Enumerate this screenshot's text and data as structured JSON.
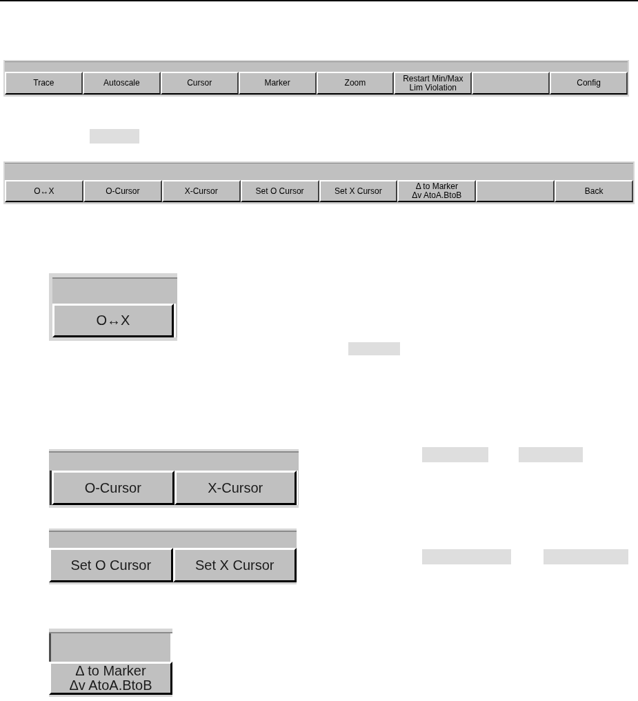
{
  "softkey_bars": [
    {
      "buttons": [
        {
          "kind": "text",
          "lines": [
            "Trace"
          ]
        },
        {
          "kind": "text",
          "lines": [
            "Autoscale"
          ]
        },
        {
          "kind": "text",
          "lines": [
            "Cursor"
          ]
        },
        {
          "kind": "text",
          "lines": [
            "Marker"
          ]
        },
        {
          "kind": "text",
          "lines": [
            "Zoom"
          ]
        },
        {
          "kind": "text",
          "lines": [
            "Restart Min/Max",
            "Lim Violation"
          ]
        },
        {
          "kind": "empty"
        },
        {
          "kind": "text",
          "lines": [
            "Config"
          ]
        }
      ]
    },
    {
      "buttons": [
        {
          "kind": "text",
          "lines": [
            "O↔X"
          ]
        },
        {
          "kind": "text",
          "lines": [
            "O-Cursor"
          ]
        },
        {
          "kind": "text",
          "lines": [
            "X-Cursor"
          ]
        },
        {
          "kind": "text",
          "lines": [
            "Set O Cursor"
          ]
        },
        {
          "kind": "text",
          "lines": [
            "Set X Cursor"
          ]
        },
        {
          "kind": "text",
          "lines": [
            "Δ to Marker",
            "Δv AtoA.BtoB"
          ]
        },
        {
          "kind": "empty"
        },
        {
          "kind": "text",
          "lines": [
            "Back"
          ]
        }
      ]
    }
  ],
  "enlarged_views": [
    {
      "buttons": [
        {
          "kind": "text",
          "lines": [
            "O↔X"
          ]
        }
      ]
    },
    {
      "buttons": [
        {
          "kind": "text",
          "lines": [
            "O-Cursor"
          ]
        },
        {
          "kind": "text",
          "lines": [
            "X-Cursor"
          ]
        }
      ]
    },
    {
      "buttons": [
        {
          "kind": "text",
          "lines": [
            "Set O Cursor"
          ]
        },
        {
          "kind": "text",
          "lines": [
            "Set X Cursor"
          ]
        }
      ]
    },
    {
      "buttons": [
        {
          "kind": "text",
          "lines": [
            "Δ to Marker",
            "Δv AtoA.BtoB"
          ]
        }
      ]
    }
  ]
}
